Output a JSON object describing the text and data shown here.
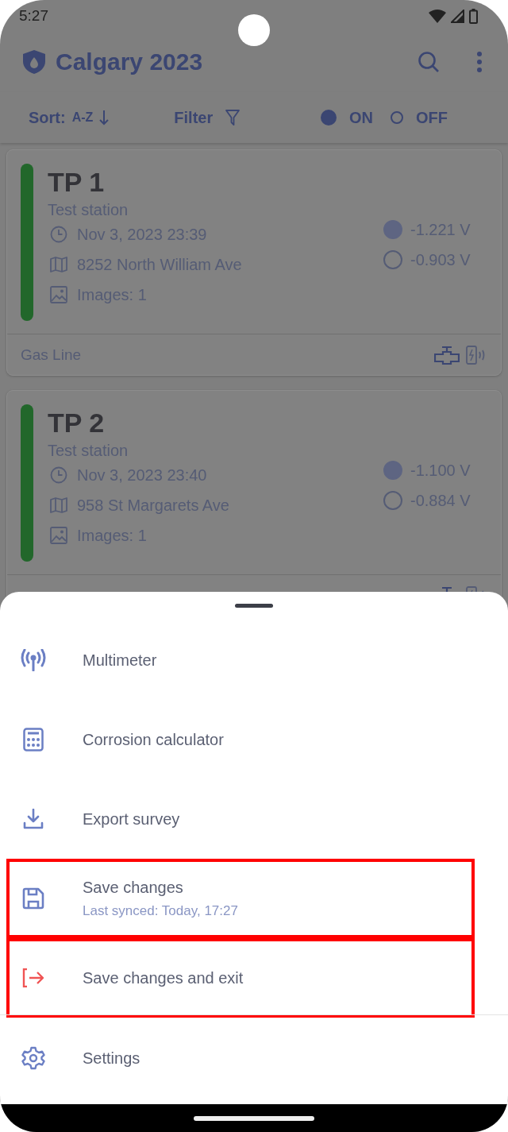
{
  "status_bar": {
    "time": "5:27"
  },
  "app_bar": {
    "title": "Calgary 2023"
  },
  "toolbar": {
    "sort_label": "Sort:",
    "sort_value": "A-Z",
    "filter_label": "Filter",
    "toggle": [
      {
        "label": "ON",
        "selected": true
      },
      {
        "label": "OFF",
        "selected": false
      }
    ]
  },
  "cards": [
    {
      "title": "TP 1",
      "subtitle": "Test station",
      "date": "Nov 3, 2023 23:39",
      "address": "8252 North William Ave",
      "images": "Images: 1",
      "color": "#22672b",
      "readings": [
        {
          "value": "-1.221 V",
          "selected": true
        },
        {
          "value": "-0.903 V",
          "selected": false
        }
      ],
      "footer": "Gas Line"
    },
    {
      "title": "TP 2",
      "subtitle": "Test station",
      "date": "Nov 3, 2023 23:40",
      "address": "958 St Margarets Ave",
      "images": "Images: 1",
      "color": "#22672b",
      "readings": [
        {
          "value": "-1.100 V",
          "selected": true
        },
        {
          "value": "-0.884 V",
          "selected": false
        }
      ]
    }
  ],
  "bottom_sheet": {
    "items": [
      {
        "label": "Multimeter",
        "highlighted": false
      },
      {
        "label": "Corrosion calculator",
        "highlighted": false
      },
      {
        "label": "Export survey",
        "highlighted": false
      },
      {
        "label": "Save changes",
        "detail": "Last synced: Today, 17:27",
        "highlighted": true
      },
      {
        "label": "Save changes and exit",
        "highlighted": true
      },
      {
        "label": "Settings",
        "highlighted": false
      }
    ]
  }
}
